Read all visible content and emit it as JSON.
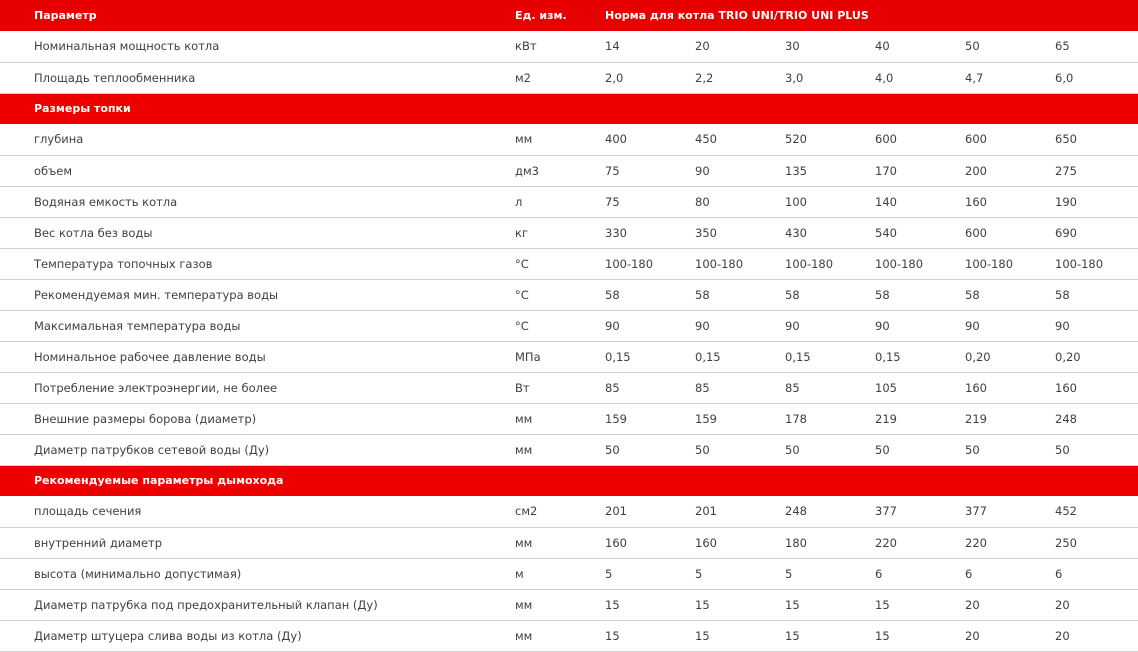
{
  "header": {
    "param": "Параметр",
    "unit": "Ед. изм.",
    "norm": "Норма для котла TRIO UNI/TRIO UNI PLUS"
  },
  "rows": [
    {
      "type": "data",
      "name": "Номинальная мощность котла",
      "unit": "кВт",
      "values": [
        "14",
        "20",
        "30",
        "40",
        "50",
        "65"
      ]
    },
    {
      "type": "data",
      "name": "Площадь теплообменника",
      "unit": "м2",
      "values": [
        "2,0",
        "2,2",
        "3,0",
        "4,0",
        "4,7",
        "6,0"
      ]
    },
    {
      "type": "section",
      "name": "Размеры топки"
    },
    {
      "type": "data",
      "name": "глубина",
      "unit": "мм",
      "values": [
        "400",
        "450",
        "520",
        "600",
        "600",
        "650"
      ]
    },
    {
      "type": "data",
      "name": "объем",
      "unit": "дм3",
      "values": [
        "75",
        "90",
        "135",
        "170",
        "200",
        "275"
      ]
    },
    {
      "type": "data",
      "name": "Водяная емкость котла",
      "unit": "л",
      "values": [
        "75",
        "80",
        "100",
        "140",
        "160",
        "190"
      ]
    },
    {
      "type": "data",
      "name": "Вес  котла без воды",
      "unit": "кг",
      "values": [
        "330",
        "350",
        "430",
        "540",
        "600",
        "690"
      ]
    },
    {
      "type": "data",
      "name": "Температура топочных газов",
      "unit": "°С",
      "values": [
        "100-180",
        "100-180",
        "100-180",
        "100-180",
        "100-180",
        "100-180"
      ]
    },
    {
      "type": "data",
      "name": "Рекомендуемая мин. температура воды",
      "unit": "°С",
      "values": [
        "58",
        "58",
        "58",
        "58",
        "58",
        "58"
      ]
    },
    {
      "type": "data",
      "name": "Максимальная температура воды",
      "unit": "°С",
      "values": [
        "90",
        "90",
        "90",
        "90",
        "90",
        "90"
      ]
    },
    {
      "type": "data",
      "name": "Номинальное рабочее давление воды",
      "unit": "МПа",
      "values": [
        "0,15",
        "0,15",
        "0,15",
        "0,15",
        "0,20",
        "0,20"
      ]
    },
    {
      "type": "data",
      "name": "Потребление электроэнергии, не более",
      "unit": "Вт",
      "values": [
        "85",
        "85",
        "85",
        "105",
        "160",
        "160"
      ]
    },
    {
      "type": "data",
      "name": "Внешние размеры борова (диаметр)",
      "unit": "мм",
      "values": [
        "159",
        "159",
        "178",
        "219",
        "219",
        "248"
      ]
    },
    {
      "type": "data",
      "name": "Диаметр патрубков сетевой воды (Ду)",
      "unit": "мм",
      "values": [
        "50",
        "50",
        "50",
        "50",
        "50",
        "50"
      ]
    },
    {
      "type": "section",
      "name": "Рекомендуемые параметры дымохода"
    },
    {
      "type": "data",
      "name": "площадь сечения",
      "unit": "см2",
      "values": [
        "201",
        "201",
        "248",
        "377",
        "377",
        "452"
      ]
    },
    {
      "type": "data",
      "name": "внутренний диаметр",
      "unit": "мм",
      "values": [
        "160",
        "160",
        "180",
        "220",
        "220",
        "250"
      ]
    },
    {
      "type": "data",
      "name": "высота (минимально допустимая)",
      "unit": "м",
      "values": [
        "5",
        "5",
        "5",
        "6",
        "6",
        "6"
      ]
    },
    {
      "type": "data",
      "name": "Диаметр патрубка под предохранительный клапан (Ду)",
      "unit": "мм",
      "values": [
        "15",
        "15",
        "15",
        "15",
        "20",
        "20"
      ]
    },
    {
      "type": "data",
      "name": "Диаметр штуцера слива воды из котла (Ду)",
      "unit": "мм",
      "values": [
        "15",
        "15",
        "15",
        "15",
        "20",
        "20"
      ]
    }
  ],
  "colors": {
    "header_bg": "#e60000",
    "section_bg": "#ef0000",
    "text": "#3f3f3f",
    "divider": "#cfcfcf"
  }
}
